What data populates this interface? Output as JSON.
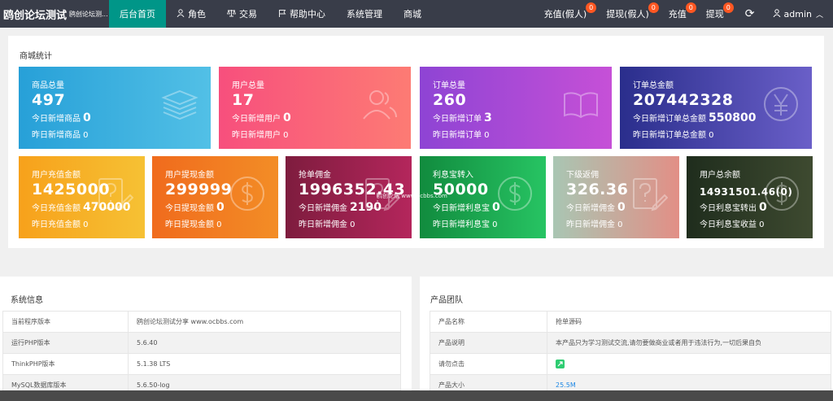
{
  "header": {
    "brand_title": "鸥创论坛测试",
    "brand_sub": "鸥创论坛测...",
    "nav": [
      {
        "label": "后台首页",
        "icon": "",
        "active": true
      },
      {
        "label": "角色",
        "icon": "user-icon"
      },
      {
        "label": "交易",
        "icon": "scale-icon"
      },
      {
        "label": "帮助中心",
        "icon": "flag-icon"
      },
      {
        "label": "系统管理",
        "icon": ""
      },
      {
        "label": "商城",
        "icon": ""
      }
    ],
    "right": [
      {
        "label": "充值(假人)",
        "badge": "0"
      },
      {
        "label": "提现(假人)",
        "badge": "0"
      },
      {
        "label": "充值",
        "badge": "0"
      },
      {
        "label": "提现",
        "badge": "0"
      }
    ],
    "refresh_icon": "refresh-icon",
    "user": "admin"
  },
  "stats": {
    "title": "商城统计",
    "row1": [
      {
        "label": "商品总量",
        "value": "497",
        "today_label": "今日新增商品",
        "today_value": "0",
        "yesterday": "昨日新增商品 0",
        "icon": "layers-icon",
        "gradient": [
          "#27a0d8",
          "#52c0e6"
        ]
      },
      {
        "label": "用户总量",
        "value": "17",
        "today_label": "今日新增用户",
        "today_value": "0",
        "yesterday": "昨日新增用户 0",
        "icon": "users-icon",
        "gradient": [
          "#f74f7d",
          "#fd7b74"
        ]
      },
      {
        "label": "订单总量",
        "value": "260",
        "today_label": "今日新增订单",
        "today_value": "3",
        "yesterday": "昨日新增订单 0",
        "icon": "book-icon",
        "gradient": [
          "#8e44d4",
          "#c650d7"
        ]
      },
      {
        "label": "订单总金额",
        "value": "207442328",
        "today_label": "今日新增订单总金额",
        "today_value": "550800",
        "yesterday": "昨日新增订单总金额 0",
        "icon": "yen-icon",
        "gradient": [
          "#2a2e8c",
          "#6a5fc8"
        ]
      }
    ],
    "row2": [
      {
        "label": "用户充值金额",
        "value": "1425000",
        "today_label": "今日充值金额",
        "today_value": "470000",
        "yesterday": "昨日充值金额 0",
        "icon": "edit-icon",
        "gradient": [
          "#f7a11b",
          "#f6c134"
        ]
      },
      {
        "label": "用户提现金额",
        "value": "299999",
        "today_label": "今日提现金额",
        "today_value": "0",
        "yesterday": "昨日提现金额 0",
        "icon": "dollar-icon",
        "gradient": [
          "#f06b1d",
          "#f38d26"
        ]
      },
      {
        "label": "抢单佣金",
        "value": "1996352.43",
        "today_label": "今日新增佣金",
        "today_value": "2190",
        "yesterday": "昨日新增佣金 0",
        "icon": "edit-icon",
        "gradient": [
          "#7e1c3e",
          "#b4265c"
        ]
      },
      {
        "label": "利息宝转入",
        "value": "50000",
        "today_label": "今日新增利息宝",
        "today_value": "0",
        "yesterday": "昨日新增利息宝 0",
        "icon": "dollar-icon",
        "gradient": [
          "#118b3e",
          "#27c463"
        ]
      },
      {
        "label": "下级返佣",
        "value": "326.36",
        "today_label": "今日新增佣金",
        "today_value": "0",
        "yesterday": "昨日新增佣金 0",
        "icon": "edit-icon",
        "gradient": [
          "#a9c6b3",
          "#e28f86"
        ]
      },
      {
        "label": "用户总余额",
        "value": "14931501.46(0)",
        "today_label": "今日利息宝转出",
        "today_value": "0",
        "yesterday": "今日利息宝收益 0",
        "icon": "dollar-icon",
        "gradient": [
          "#1f2d1d",
          "#3e4a30"
        ]
      }
    ],
    "watermark": "鸥创论坛 www.ocbbs.com"
  },
  "system": {
    "title": "系统信息",
    "rows": [
      {
        "k": "当前程序版本",
        "v": "鸥创论坛测试分享 www.ocbbs.com"
      },
      {
        "k": "运行PHP版本",
        "v": "5.6.40"
      },
      {
        "k": "ThinkPHP版本",
        "v": "5.1.38 LTS"
      },
      {
        "k": "MySQL数据库版本",
        "v": "5.6.50-log"
      }
    ]
  },
  "product": {
    "title": "产品团队",
    "rows": [
      {
        "k": "产品名称",
        "v": "抢单源码"
      },
      {
        "k": "产品说明",
        "v": "本产品只为学习测试交流,请勿要做商业或者用于违法行为,一切后果自负"
      },
      {
        "k": "请勿点击",
        "v": ""
      },
      {
        "k": "产品大小",
        "v": "25.5M"
      }
    ]
  }
}
